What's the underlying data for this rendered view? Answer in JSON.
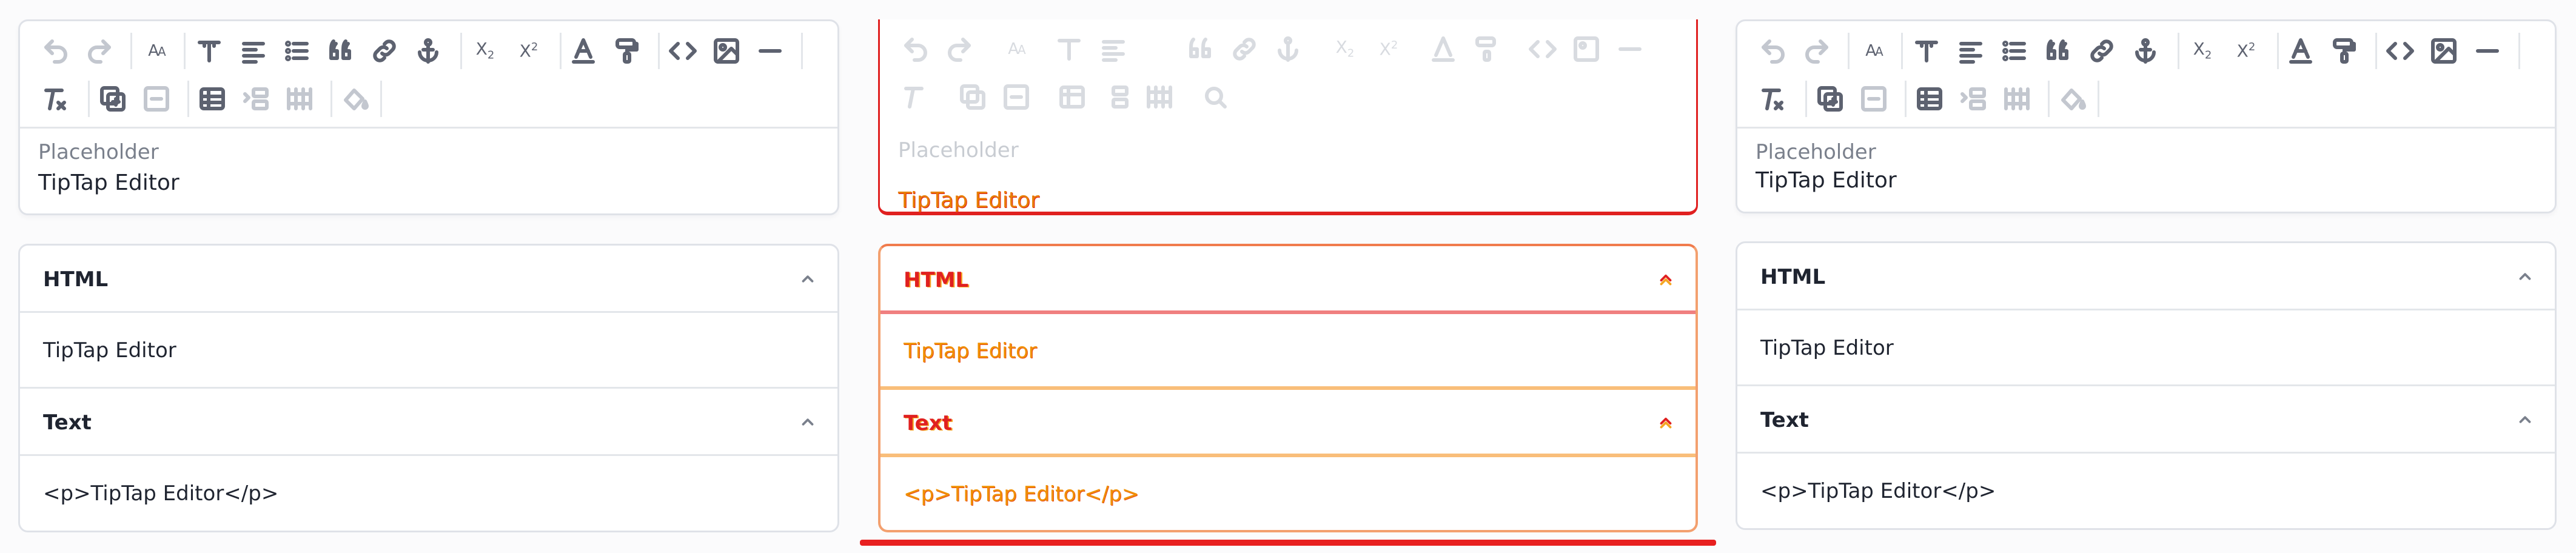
{
  "editor": {
    "placeholder": "Placeholder",
    "content": "TipTap Editor",
    "toolbar_row1": [
      {
        "icon": "undo-icon",
        "disabled": true
      },
      {
        "icon": "redo-icon",
        "disabled": true
      },
      {
        "icon": "font-size-icon",
        "glyph": "AA"
      },
      {
        "icon": "heading-icon"
      },
      {
        "icon": "align-icon"
      },
      {
        "icon": "bullet-list-icon"
      },
      {
        "icon": "blockquote-icon"
      },
      {
        "icon": "link-icon"
      },
      {
        "icon": "anchor-icon"
      },
      {
        "icon": "subscript-icon",
        "glyph": "X₂"
      },
      {
        "icon": "superscript-icon",
        "glyph": "X²"
      },
      {
        "icon": "text-color-icon"
      },
      {
        "icon": "format-painter-icon"
      },
      {
        "icon": "code-icon"
      },
      {
        "icon": "image-icon"
      },
      {
        "icon": "horizontal-rule-icon"
      }
    ],
    "toolbar_row2": [
      {
        "icon": "clear-format-icon"
      },
      {
        "icon": "add-table-icon"
      },
      {
        "icon": "remove-icon",
        "disabled": true
      },
      {
        "icon": "table-icon"
      },
      {
        "icon": "add-row-icon",
        "disabled": true
      },
      {
        "icon": "delete-grid-icon",
        "disabled": true
      },
      {
        "icon": "fill-color-icon",
        "disabled": true
      }
    ]
  },
  "outputs": {
    "html_label": "HTML",
    "html_value": "TipTap Editor",
    "text_label": "Text",
    "text_value": "<p>TipTap Editor</p>"
  }
}
